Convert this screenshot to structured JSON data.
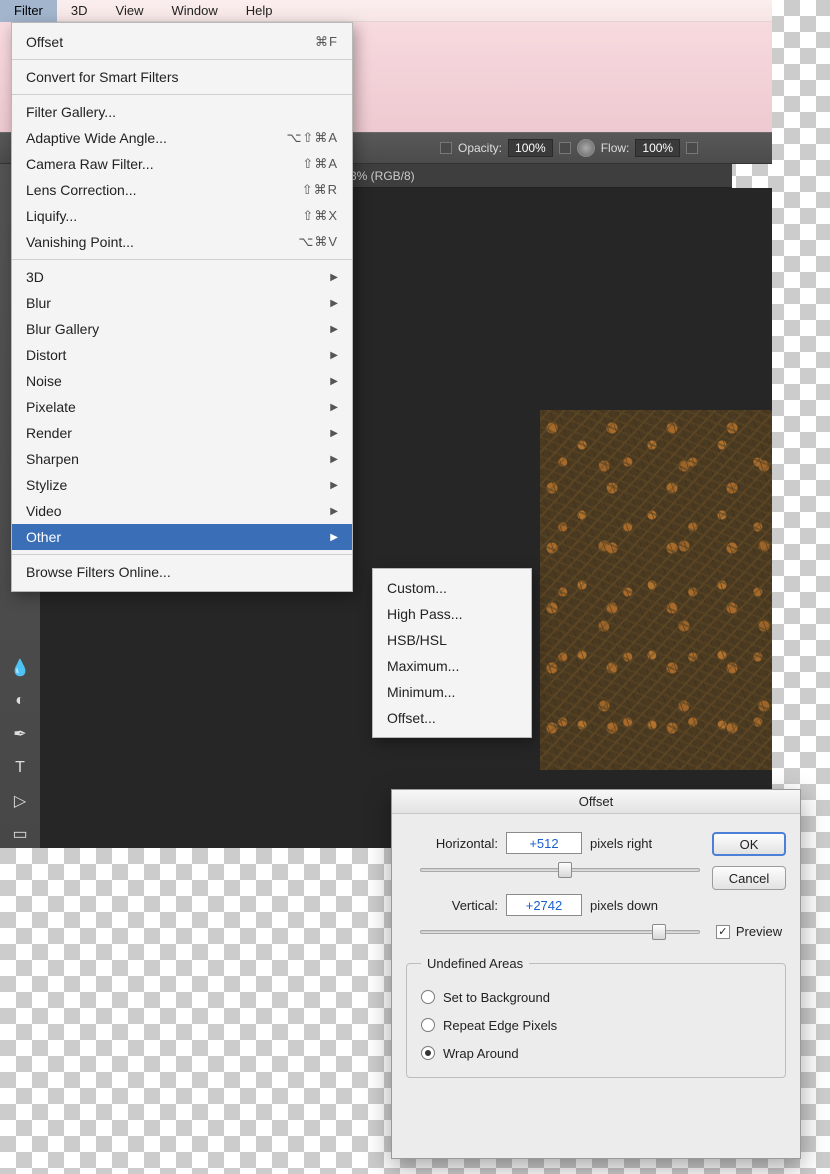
{
  "menubar": [
    "Filter",
    "3D",
    "View",
    "Window",
    "Help"
  ],
  "options_bar": {
    "opacity_label": "Opacity:",
    "opacity_value": "100%",
    "flow_label": "Flow:",
    "flow_value": "100%"
  },
  "doc_tab": "3% (RGB/8)",
  "filter_menu": {
    "last": {
      "label": "Offset",
      "shortcut": "⌘F"
    },
    "convert": "Convert for Smart Filters",
    "group2": [
      {
        "label": "Filter Gallery..."
      },
      {
        "label": "Adaptive Wide Angle...",
        "shortcut": "⌥⇧⌘A"
      },
      {
        "label": "Camera Raw Filter...",
        "shortcut": "⇧⌘A"
      },
      {
        "label": "Lens Correction...",
        "shortcut": "⇧⌘R"
      },
      {
        "label": "Liquify...",
        "shortcut": "⇧⌘X"
      },
      {
        "label": "Vanishing Point...",
        "shortcut": "⌥⌘V"
      }
    ],
    "group3": [
      "3D",
      "Blur",
      "Blur Gallery",
      "Distort",
      "Noise",
      "Pixelate",
      "Render",
      "Sharpen",
      "Stylize",
      "Video",
      "Other"
    ],
    "browse": "Browse Filters Online..."
  },
  "other_submenu": [
    "Custom...",
    "High Pass...",
    "HSB/HSL",
    "Maximum...",
    "Minimum...",
    "Offset..."
  ],
  "offset_dialog": {
    "title": "Offset",
    "horizontal_label": "Horizontal:",
    "horizontal_value": "+512",
    "horizontal_unit": "pixels right",
    "vertical_label": "Vertical:",
    "vertical_value": "+2742",
    "vertical_unit": "pixels down",
    "ok": "OK",
    "cancel": "Cancel",
    "preview": "Preview",
    "preview_checked": true,
    "undefined_legend": "Undefined Areas",
    "radios": [
      {
        "label": "Set to Background",
        "checked": false
      },
      {
        "label": "Repeat Edge Pixels",
        "checked": false
      },
      {
        "label": "Wrap Around",
        "checked": true
      }
    ]
  }
}
